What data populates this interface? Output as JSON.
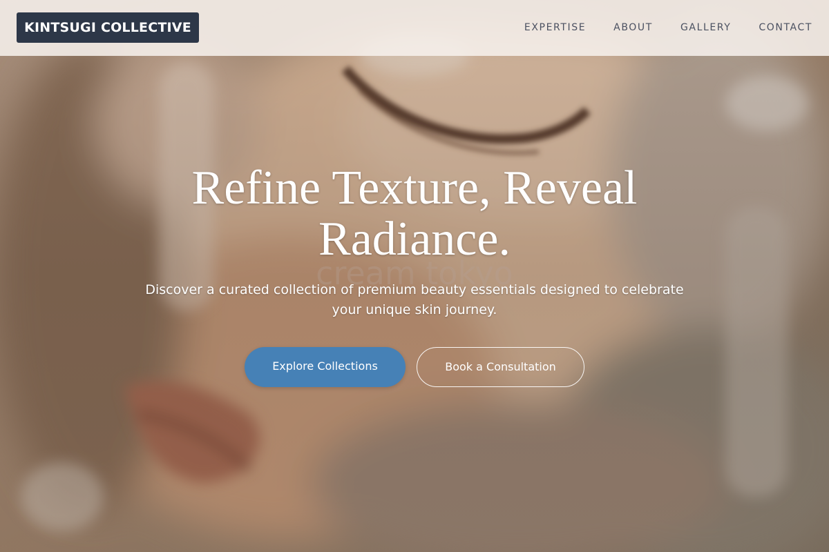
{
  "brand": {
    "name": "KINTSUGI COLLECTIVE"
  },
  "nav": {
    "items": [
      {
        "label": "EXPERTISE"
      },
      {
        "label": "ABOUT"
      },
      {
        "label": "GALLERY"
      },
      {
        "label": "CONTACT"
      }
    ]
  },
  "hero": {
    "headline_line1": "Refine Texture, Reveal",
    "headline_line2": "Radiance.",
    "watermark": "cream tokyo",
    "subtitle_line1": "Discover a curated collection of premium beauty essentials designed to celebrate",
    "subtitle_line2": "your unique skin journey.",
    "primary_cta": "Explore Collections",
    "secondary_cta": "Book a Consultation"
  },
  "colors": {
    "logo_bg": "#2d3748",
    "primary_button": "#4681b6",
    "header_bg": "#f6f0ec"
  }
}
